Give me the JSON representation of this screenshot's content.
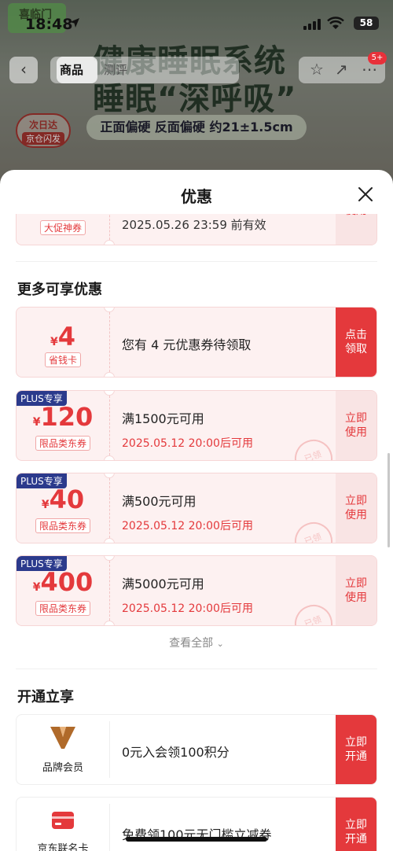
{
  "status_bar": {
    "time": "18:48",
    "battery": "58",
    "shop_badge": "喜临门"
  },
  "nav": {
    "tab_goods": "商品",
    "tab_review": "测评",
    "badge": "5+"
  },
  "promo": {
    "title_line1": "健康睡眠系统",
    "title_line2": "睡眠“深呼吸”",
    "subtitle": "正面偏硬 反面偏硬 约21±1.5cm",
    "delivery_line1": "次日达",
    "delivery_line2": "京仓闪发"
  },
  "sheet": {
    "title": "优惠"
  },
  "partial_coupon": {
    "tag": "大促神券",
    "text": "2025.05.26 23:59 前有效",
    "action": "使用"
  },
  "more_offers": {
    "title": "更多可享优惠",
    "card": {
      "currency": "¥",
      "amount": "4",
      "tag": "省钱卡",
      "text": "您有 4 元优惠券待领取",
      "action": "点击领取"
    },
    "coupons": [
      {
        "plus": "PLUS专享",
        "currency": "¥",
        "amount": "120",
        "tag": "限品类东券",
        "main": "满1500元可用",
        "sub": "2025.05.12 20:00后可用",
        "action": "立即使用",
        "stamp": "已领"
      },
      {
        "plus": "PLUS专享",
        "currency": "¥",
        "amount": "40",
        "tag": "限品类东券",
        "main": "满500元可用",
        "sub": "2025.05.12 20:00后可用",
        "action": "立即使用",
        "stamp": "已领"
      },
      {
        "plus": "PLUS专享",
        "currency": "¥",
        "amount": "400",
        "tag": "限品类东券",
        "main": "满5000元可用",
        "sub": "2025.05.12 20:00后可用",
        "action": "立即使用",
        "stamp": "已领"
      }
    ],
    "view_all": "查看全部"
  },
  "open_enjoy": {
    "title": "开通立享",
    "items": [
      {
        "label": "品牌会员",
        "icon": "brand-v-icon",
        "text": "0元入会领100积分",
        "action": "立即开通"
      },
      {
        "label": "京东联名卡",
        "icon": "credit-card-icon",
        "text": "免费领100元无门槛立减券",
        "action": "立即开通"
      }
    ]
  },
  "colors": {
    "accent": "#e4393c",
    "plus": "#2b3a8c",
    "coupon_bg": "#fdf1f1"
  }
}
